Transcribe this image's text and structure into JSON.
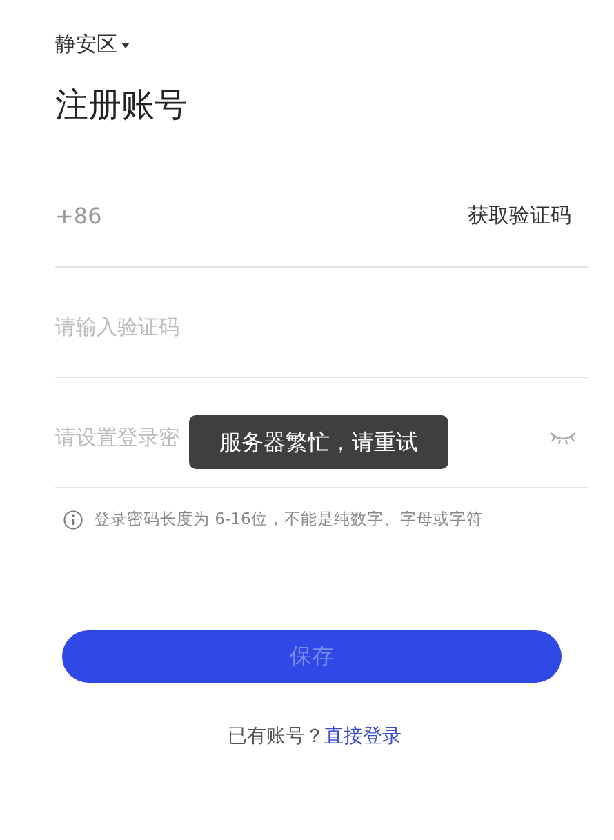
{
  "region": {
    "label": "静安区"
  },
  "title": "注册账号",
  "fields": [
    {
      "kind": "phone",
      "prefix": "+86",
      "action": "获取验证码"
    },
    {
      "kind": "code",
      "placeholder": "请输入验证码"
    },
    {
      "kind": "password",
      "placeholder": "请设置登录密"
    }
  ],
  "hint": "登录密码长度为 6-16位，不能是纯数字、字母或字符",
  "save_button": {
    "label": "保存",
    "disabled": true
  },
  "footer": {
    "text": "已有账号？",
    "link": "直接登录"
  },
  "toast": {
    "text": "服务器繁忙，请重试"
  }
}
